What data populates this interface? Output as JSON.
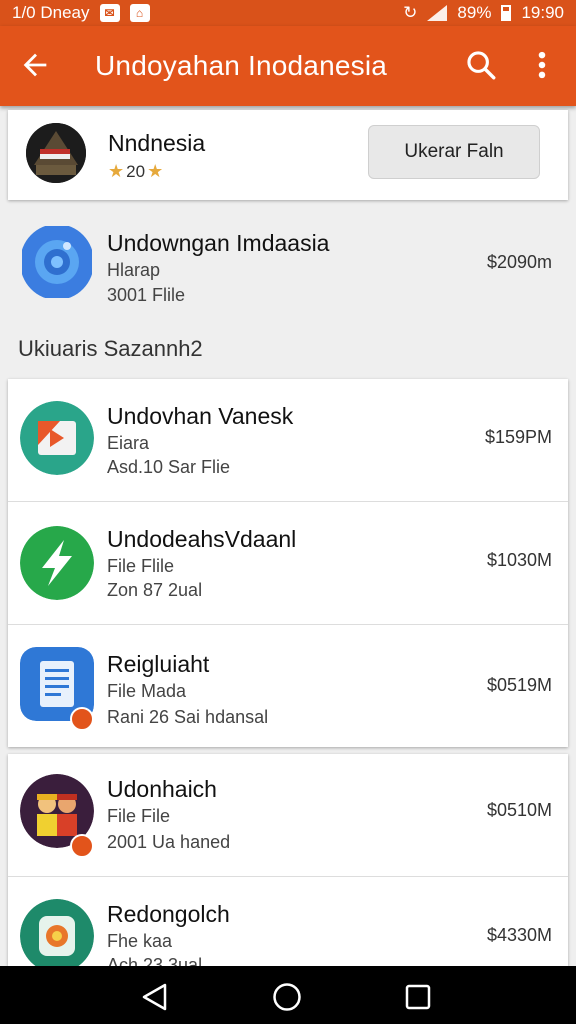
{
  "status_bar": {
    "left_text": "1/0 Dneay",
    "battery": "89%",
    "time": "19:90"
  },
  "app_bar": {
    "title": "Undoyahan Inodanesia"
  },
  "developer": {
    "name": "Nndnesia",
    "rating": "20",
    "follow_label": "Ukerar Faln"
  },
  "featured": {
    "title": "Undowngan Imdaasia",
    "subtitle": "Hlarap",
    "meta": "3001 Flile",
    "price": "$2090m"
  },
  "section": {
    "heading": "Ukiuaris Sazannh2"
  },
  "apps": [
    {
      "title": "Undovhan Vanesk",
      "subtitle": "Eiara",
      "meta": "Asd.10 Sar Flie",
      "price": "$159PM"
    },
    {
      "title": "UndodeahsVdaanl",
      "subtitle": "File Flile",
      "meta": "Zon 87 2ual",
      "price": "$1030M"
    },
    {
      "title": "Reigluiaht",
      "subtitle": "File Mada",
      "meta": "Rani 26 Sai hdansal",
      "price": "$0519M"
    },
    {
      "title": "Udonhaich",
      "subtitle": "File File",
      "meta": "2001 Ua haned",
      "price": "$0510M"
    },
    {
      "title": "Redongolch",
      "subtitle": "Fhe kaa",
      "meta": "Ach 23 3ual",
      "price": "$4330M"
    }
  ]
}
